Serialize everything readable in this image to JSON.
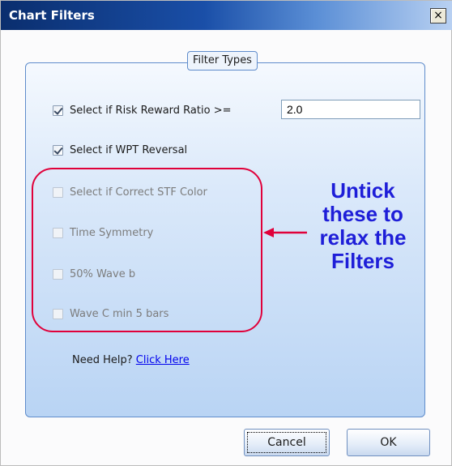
{
  "window": {
    "title": "Chart Filters",
    "close_glyph": "×"
  },
  "group": {
    "legend": "Filter Types"
  },
  "filters": [
    {
      "label": "Select if Risk Reward Ratio >=",
      "checked": true
    },
    {
      "label": "Select if WPT Reversal",
      "checked": true
    },
    {
      "label": "Select if Correct STF Color",
      "checked": false
    },
    {
      "label": "Time Symmetry",
      "checked": false
    },
    {
      "label": "50% Wave b",
      "checked": false
    },
    {
      "label": "Wave C min 5 bars",
      "checked": false
    }
  ],
  "rr_input": {
    "value": "2.0"
  },
  "help": {
    "prefix": "Need Help?",
    "link": "Click Here"
  },
  "annotation": {
    "lines": [
      "Untick",
      "these to",
      "relax the",
      "Filters"
    ],
    "color": "#1e1ed8",
    "highlight_color": "#e0003a"
  },
  "buttons": {
    "cancel": "Cancel",
    "ok": "OK"
  }
}
